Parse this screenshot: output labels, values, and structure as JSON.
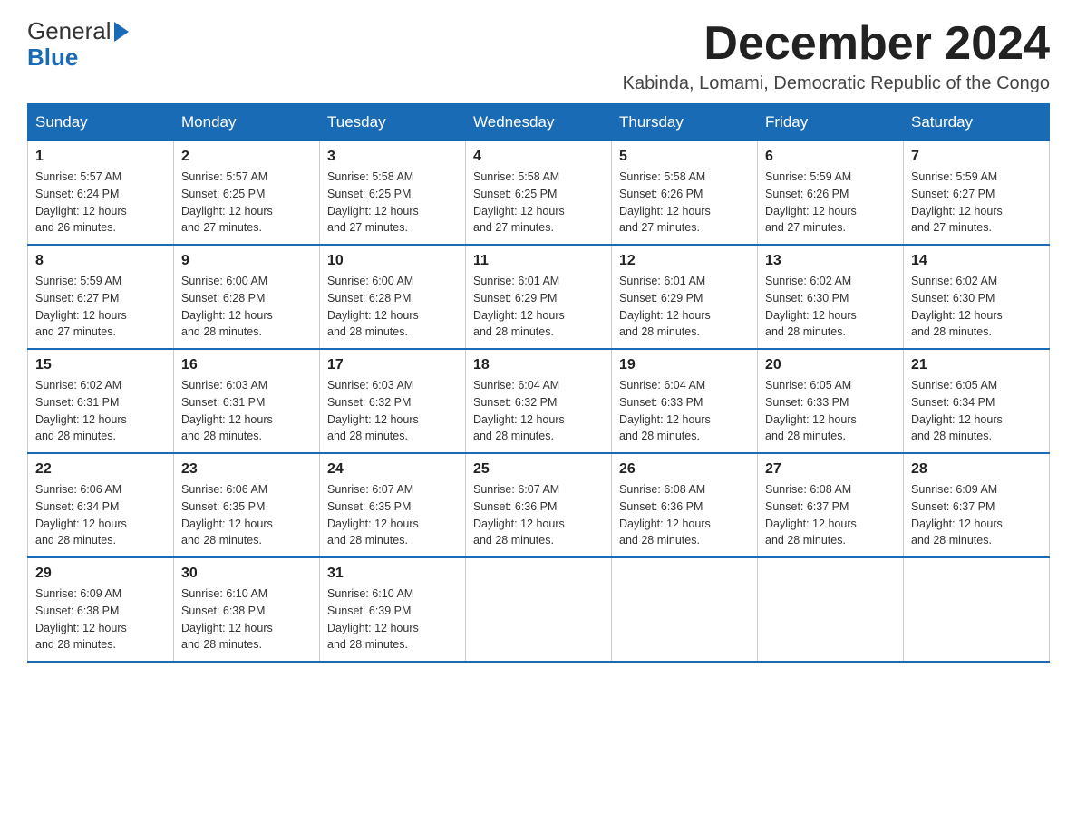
{
  "header": {
    "logo_text_general": "General",
    "logo_text_blue": "Blue",
    "month_title": "December 2024",
    "location": "Kabinda, Lomami, Democratic Republic of the Congo"
  },
  "days_of_week": [
    "Sunday",
    "Monday",
    "Tuesday",
    "Wednesday",
    "Thursday",
    "Friday",
    "Saturday"
  ],
  "weeks": [
    [
      {
        "day": "1",
        "sunrise": "5:57 AM",
        "sunset": "6:24 PM",
        "daylight": "12 hours and 26 minutes."
      },
      {
        "day": "2",
        "sunrise": "5:57 AM",
        "sunset": "6:25 PM",
        "daylight": "12 hours and 27 minutes."
      },
      {
        "day": "3",
        "sunrise": "5:58 AM",
        "sunset": "6:25 PM",
        "daylight": "12 hours and 27 minutes."
      },
      {
        "day": "4",
        "sunrise": "5:58 AM",
        "sunset": "6:25 PM",
        "daylight": "12 hours and 27 minutes."
      },
      {
        "day": "5",
        "sunrise": "5:58 AM",
        "sunset": "6:26 PM",
        "daylight": "12 hours and 27 minutes."
      },
      {
        "day": "6",
        "sunrise": "5:59 AM",
        "sunset": "6:26 PM",
        "daylight": "12 hours and 27 minutes."
      },
      {
        "day": "7",
        "sunrise": "5:59 AM",
        "sunset": "6:27 PM",
        "daylight": "12 hours and 27 minutes."
      }
    ],
    [
      {
        "day": "8",
        "sunrise": "5:59 AM",
        "sunset": "6:27 PM",
        "daylight": "12 hours and 27 minutes."
      },
      {
        "day": "9",
        "sunrise": "6:00 AM",
        "sunset": "6:28 PM",
        "daylight": "12 hours and 28 minutes."
      },
      {
        "day": "10",
        "sunrise": "6:00 AM",
        "sunset": "6:28 PM",
        "daylight": "12 hours and 28 minutes."
      },
      {
        "day": "11",
        "sunrise": "6:01 AM",
        "sunset": "6:29 PM",
        "daylight": "12 hours and 28 minutes."
      },
      {
        "day": "12",
        "sunrise": "6:01 AM",
        "sunset": "6:29 PM",
        "daylight": "12 hours and 28 minutes."
      },
      {
        "day": "13",
        "sunrise": "6:02 AM",
        "sunset": "6:30 PM",
        "daylight": "12 hours and 28 minutes."
      },
      {
        "day": "14",
        "sunrise": "6:02 AM",
        "sunset": "6:30 PM",
        "daylight": "12 hours and 28 minutes."
      }
    ],
    [
      {
        "day": "15",
        "sunrise": "6:02 AM",
        "sunset": "6:31 PM",
        "daylight": "12 hours and 28 minutes."
      },
      {
        "day": "16",
        "sunrise": "6:03 AM",
        "sunset": "6:31 PM",
        "daylight": "12 hours and 28 minutes."
      },
      {
        "day": "17",
        "sunrise": "6:03 AM",
        "sunset": "6:32 PM",
        "daylight": "12 hours and 28 minutes."
      },
      {
        "day": "18",
        "sunrise": "6:04 AM",
        "sunset": "6:32 PM",
        "daylight": "12 hours and 28 minutes."
      },
      {
        "day": "19",
        "sunrise": "6:04 AM",
        "sunset": "6:33 PM",
        "daylight": "12 hours and 28 minutes."
      },
      {
        "day": "20",
        "sunrise": "6:05 AM",
        "sunset": "6:33 PM",
        "daylight": "12 hours and 28 minutes."
      },
      {
        "day": "21",
        "sunrise": "6:05 AM",
        "sunset": "6:34 PM",
        "daylight": "12 hours and 28 minutes."
      }
    ],
    [
      {
        "day": "22",
        "sunrise": "6:06 AM",
        "sunset": "6:34 PM",
        "daylight": "12 hours and 28 minutes."
      },
      {
        "day": "23",
        "sunrise": "6:06 AM",
        "sunset": "6:35 PM",
        "daylight": "12 hours and 28 minutes."
      },
      {
        "day": "24",
        "sunrise": "6:07 AM",
        "sunset": "6:35 PM",
        "daylight": "12 hours and 28 minutes."
      },
      {
        "day": "25",
        "sunrise": "6:07 AM",
        "sunset": "6:36 PM",
        "daylight": "12 hours and 28 minutes."
      },
      {
        "day": "26",
        "sunrise": "6:08 AM",
        "sunset": "6:36 PM",
        "daylight": "12 hours and 28 minutes."
      },
      {
        "day": "27",
        "sunrise": "6:08 AM",
        "sunset": "6:37 PM",
        "daylight": "12 hours and 28 minutes."
      },
      {
        "day": "28",
        "sunrise": "6:09 AM",
        "sunset": "6:37 PM",
        "daylight": "12 hours and 28 minutes."
      }
    ],
    [
      {
        "day": "29",
        "sunrise": "6:09 AM",
        "sunset": "6:38 PM",
        "daylight": "12 hours and 28 minutes."
      },
      {
        "day": "30",
        "sunrise": "6:10 AM",
        "sunset": "6:38 PM",
        "daylight": "12 hours and 28 minutes."
      },
      {
        "day": "31",
        "sunrise": "6:10 AM",
        "sunset": "6:39 PM",
        "daylight": "12 hours and 28 minutes."
      },
      null,
      null,
      null,
      null
    ]
  ],
  "labels": {
    "sunrise": "Sunrise:",
    "sunset": "Sunset:",
    "daylight": "Daylight:"
  },
  "colors": {
    "header_bg": "#1a6bb5",
    "header_text": "#ffffff",
    "border": "#1a6bb5"
  }
}
